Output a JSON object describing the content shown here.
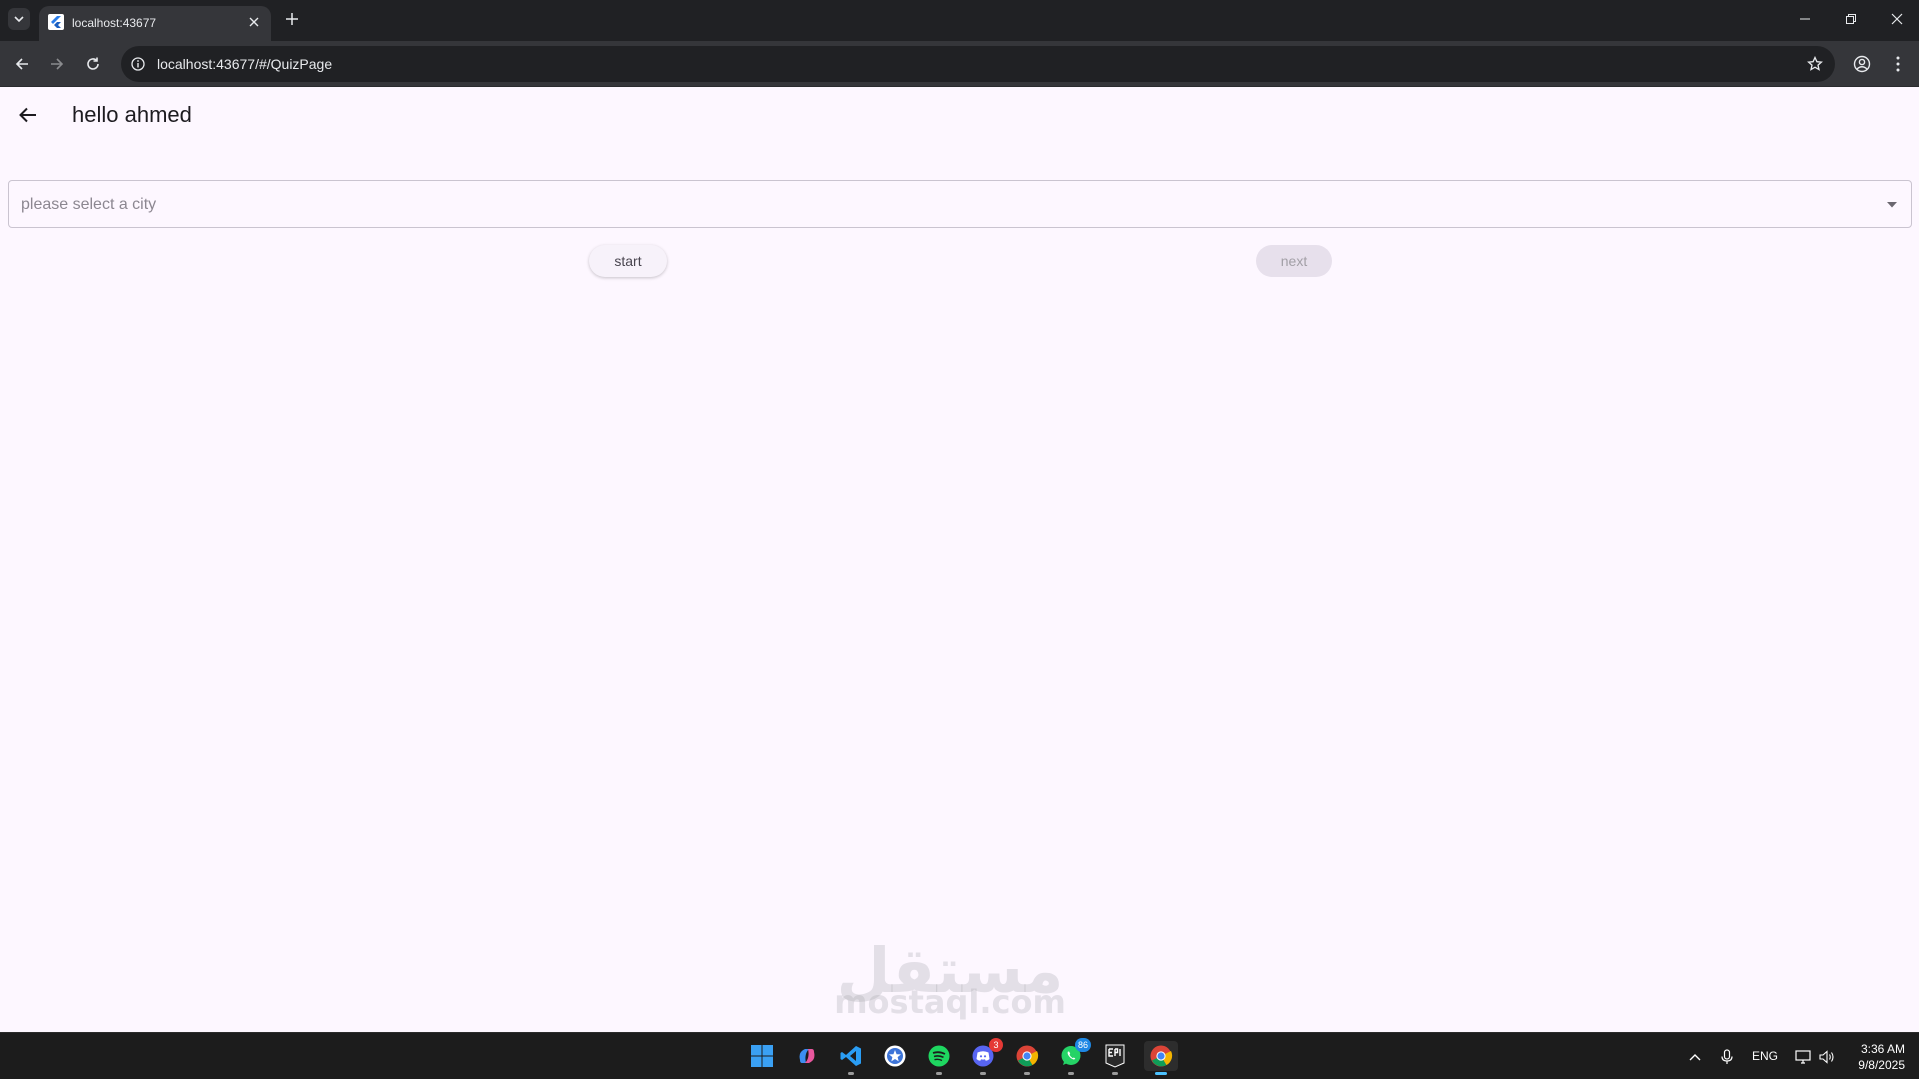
{
  "browser": {
    "tab_title": "localhost:43677",
    "url": "localhost:43677/#/QuizPage"
  },
  "app": {
    "title": "hello ahmed",
    "dropdown": {
      "placeholder": "please select a city",
      "selected": ""
    },
    "buttons": {
      "start": "start",
      "next": "next"
    },
    "watermark": {
      "arabic": "مستقل",
      "latin": "mostaql.com"
    }
  },
  "taskbar": {
    "apps": [
      {
        "name": "start",
        "icon": "windows-start-icon"
      },
      {
        "name": "copilot",
        "icon": "copilot-icon"
      },
      {
        "name": "vscode",
        "icon": "vscode-icon"
      },
      {
        "name": "app-store",
        "icon": "app-store-icon"
      },
      {
        "name": "spotify",
        "icon": "spotify-icon"
      },
      {
        "name": "discord",
        "icon": "discord-icon",
        "badge": "3"
      },
      {
        "name": "chrome",
        "icon": "chrome-icon"
      },
      {
        "name": "whatsapp",
        "icon": "whatsapp-icon",
        "badge": "86"
      },
      {
        "name": "epic-games",
        "icon": "epic-games-icon"
      },
      {
        "name": "chrome-active",
        "icon": "chrome-icon"
      }
    ],
    "language": "ENG",
    "time": "3:36 AM",
    "date": "9/8/2025"
  },
  "colors": {
    "page_background": "#fdf7ff",
    "browser_dark": "#202124",
    "toolbar": "#35363a",
    "taskbar": "#1c1c1c",
    "accent": "#4cc2ff",
    "discord_badge": "#e53935",
    "whatsapp_badge": "#1e88e5"
  }
}
